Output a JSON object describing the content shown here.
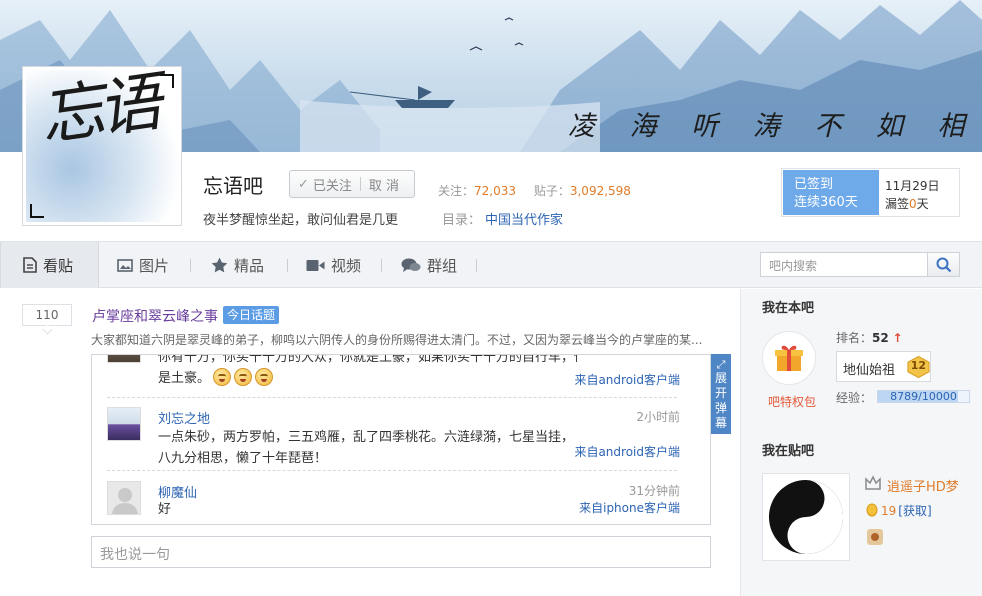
{
  "banner": {
    "slogan": "凌 海 听 涛  不 如 相 忘 江 湖"
  },
  "forum": {
    "logo_text": "忘语",
    "name": "忘语吧",
    "follow_label": "已关注",
    "unfollow_label": "取 消",
    "follow_count_label": "关注：",
    "follow_count": "72,033",
    "post_count_label": "贴子：",
    "post_count": "3,092,598",
    "motto": "夜半梦醒惊坐起，敢问仙君是几更",
    "directory_label": "目录：",
    "directory": "中国当代作家"
  },
  "signin": {
    "status": "已签到",
    "streak": "连续360天",
    "date": "11月29日",
    "missed_label": "漏签",
    "missed_count": "0",
    "missed_unit": "天"
  },
  "nav": {
    "tabs": [
      {
        "label": "看贴",
        "icon": "document-icon"
      },
      {
        "label": "图片",
        "icon": "image-icon"
      },
      {
        "label": "精品",
        "icon": "star-icon"
      },
      {
        "label": "视频",
        "icon": "video-icon"
      },
      {
        "label": "群组",
        "icon": "chat-icon"
      }
    ],
    "search_placeholder": "吧内搜索"
  },
  "thread": {
    "reply_count": "110",
    "title": "卢掌座和翠云峰之事",
    "hot_badge": "今日话题",
    "abstract": "大家都知道六阴是翠灵峰的弟子，柳鸣以六阴传人的身份所赐得进太清门。不过，又因为翠云峰当今的卢掌座的某...",
    "comments": [
      {
        "text_line1": "你有千万，你买千千万的大众，你就是土豪，如果你买千千万的自行车，你就",
        "text_line2": "是土豪。",
        "emoticons": 3,
        "source": "来自android客户端"
      },
      {
        "name": "刘忘之地",
        "time": "2小时前",
        "text": "一点朱砂，两方罗帕，三五鸡雁，乱了四季桃花。六涟绿漪，七星当挂，八九分相思，懒了十年琵琶！",
        "source": "来自android客户端"
      },
      {
        "name": "柳魔仙",
        "time": "31分钟前",
        "text": "好",
        "source": "来自iphone客户端"
      }
    ],
    "expand_label": "展开弹幕",
    "reply_placeholder": "我也说一句"
  },
  "sidebar": {
    "my_forum_title": "我在本吧",
    "privilege_label": "吧特权包",
    "rank_label": "排名：",
    "rank_value": "52",
    "level_title": "地仙始祖",
    "level_number": "12",
    "exp_label": "经验：",
    "exp_value": "8789/10000",
    "exp_fraction": 0.8789,
    "my_tieba_title": "我在贴吧",
    "username": "逍遥子HD梦",
    "coins": "19",
    "get_coins_label": "[获取]"
  }
}
